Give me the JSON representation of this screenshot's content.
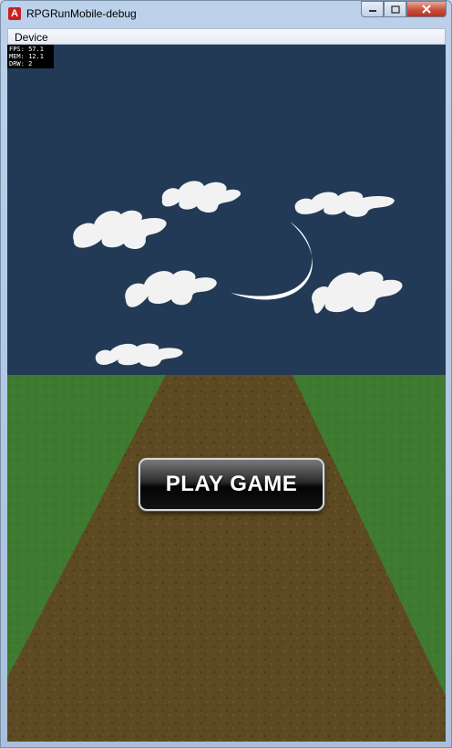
{
  "window": {
    "title": "RPGRunMobile-debug",
    "app_icon": "adobe-air-icon"
  },
  "window_controls": {
    "minimize_icon": "minimize-icon",
    "maximize_icon": "maximize-icon",
    "close_icon": "close-icon"
  },
  "menu": {
    "device_label": "Device"
  },
  "stats": {
    "fps": "FPS: 57.1",
    "mem": "MEM: 12.1",
    "drw": "DRW: 2"
  },
  "game": {
    "play_button_label": "PLAY GAME",
    "sky_color": "#223a56",
    "grass_color": "#3f7a31",
    "path_color": "#5e4a22",
    "cloud_color": "#f2f2f2"
  }
}
